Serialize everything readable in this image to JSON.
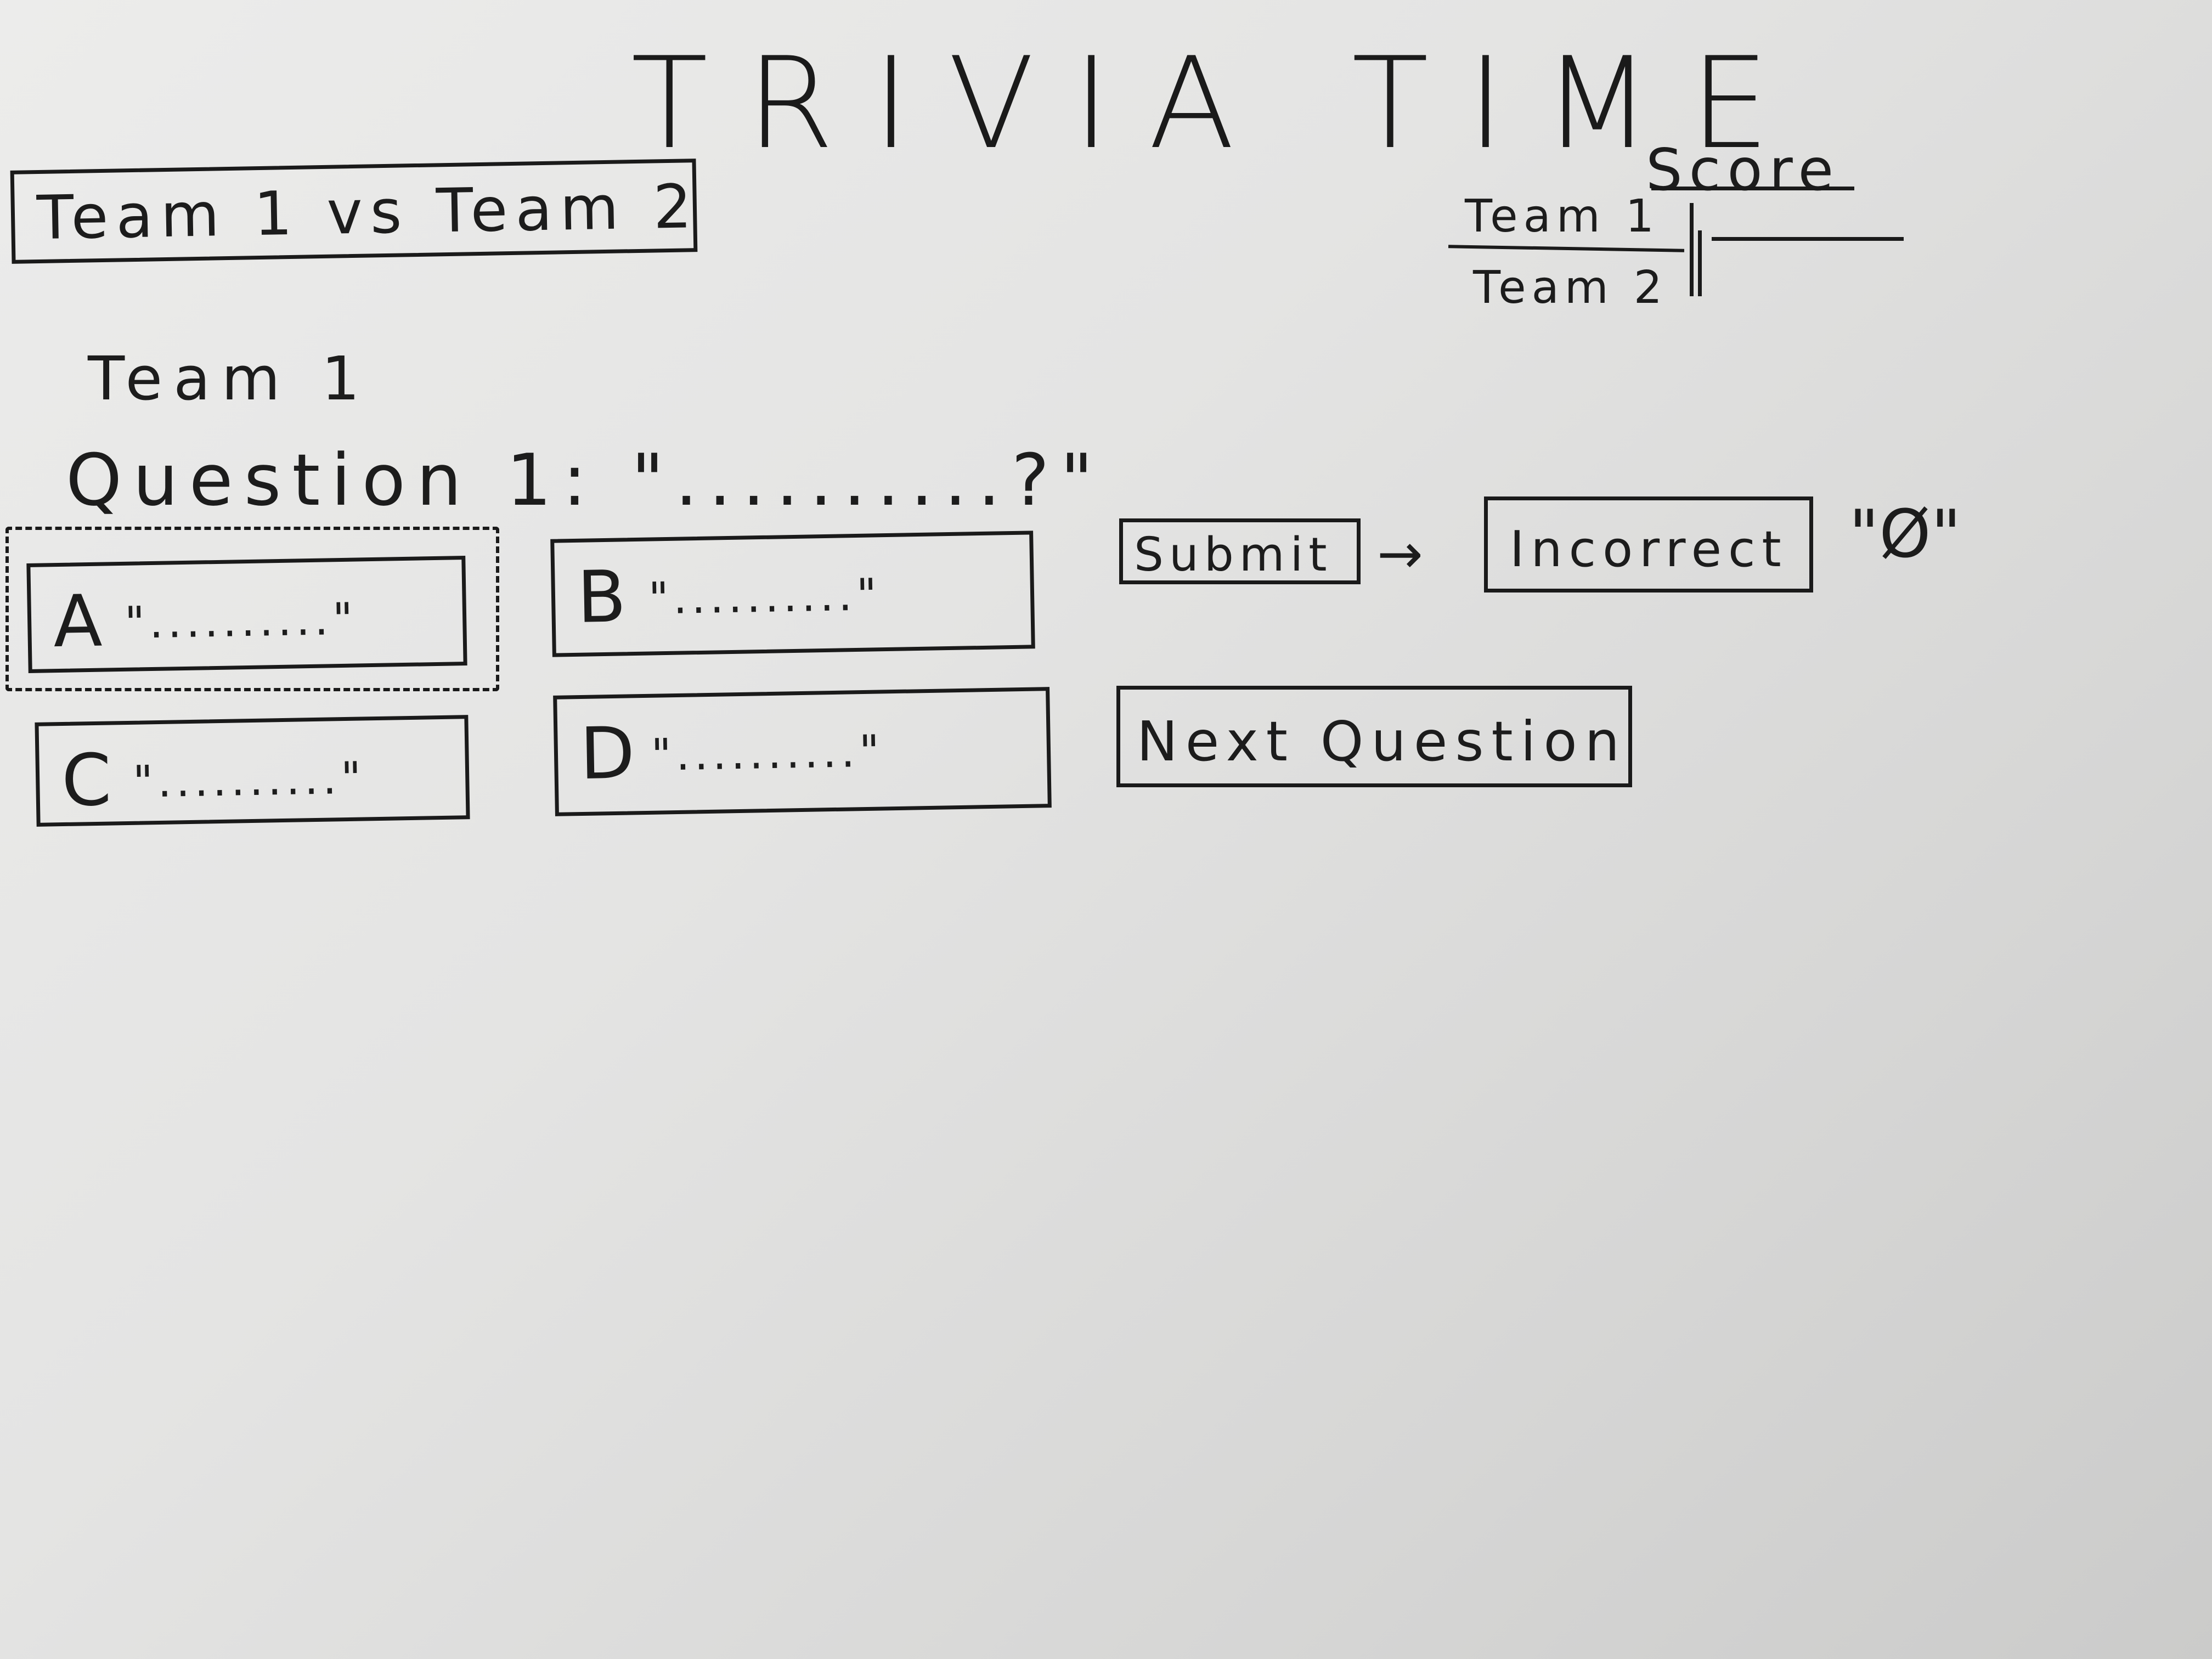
{
  "header": {
    "title": "TRIVIA TIME",
    "matchup": "Team 1 vs Team 2"
  },
  "score": {
    "title": "Score",
    "team1_label": "Team 1",
    "team2_label": "Team 2"
  },
  "turn": {
    "team_label": "Team 1"
  },
  "question": {
    "text": "Question 1: \"..........?\""
  },
  "answers": [
    {
      "letter": "A",
      "text": "\"..........\"",
      "selected": true
    },
    {
      "letter": "B",
      "text": "\"..........\"",
      "selected": false
    },
    {
      "letter": "C",
      "text": "\"..........\"",
      "selected": false
    },
    {
      "letter": "D",
      "text": "\"..........\"",
      "selected": false
    }
  ],
  "actions": {
    "submit_label": "Submit",
    "arrow": "→",
    "result_label": "Incorrect",
    "result_value": "\"Ø\"",
    "next_label": "Next Question"
  }
}
